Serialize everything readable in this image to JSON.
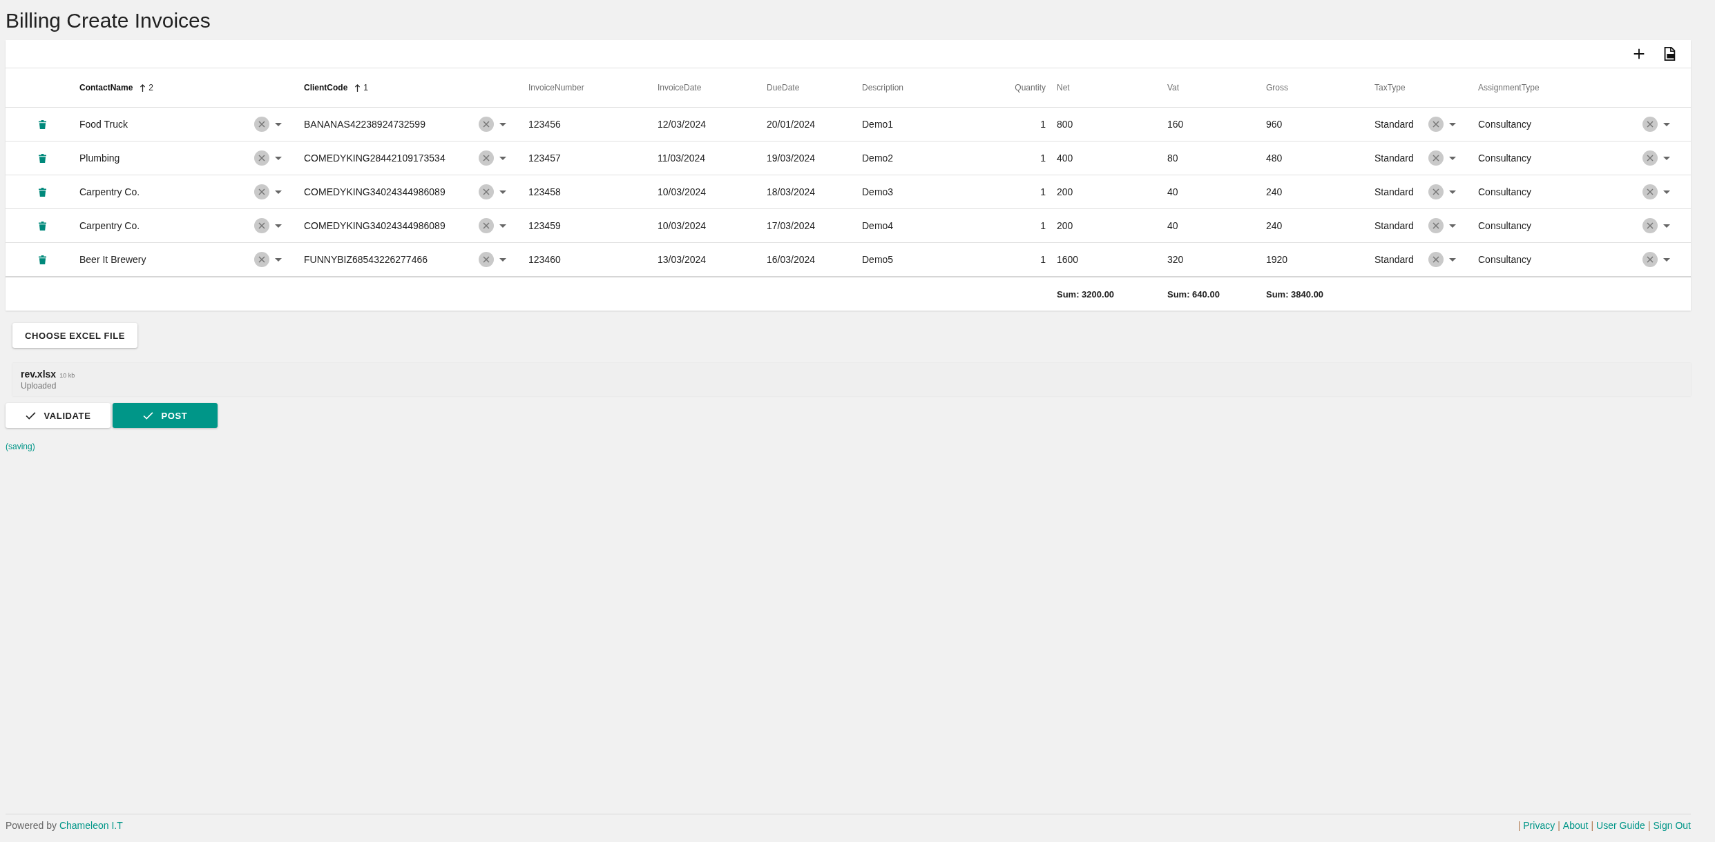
{
  "page_title": "Billing Create Invoices",
  "table": {
    "columns": [
      {
        "label": "ContactName",
        "sorted": true,
        "sort_order": "2",
        "kind": "select"
      },
      {
        "label": "ClientCode",
        "sorted": true,
        "sort_order": "1",
        "kind": "select"
      },
      {
        "label": "InvoiceNumber",
        "sorted": false,
        "kind": "text"
      },
      {
        "label": "InvoiceDate",
        "sorted": false,
        "kind": "text"
      },
      {
        "label": "DueDate",
        "sorted": false,
        "kind": "text"
      },
      {
        "label": "Description",
        "sorted": false,
        "kind": "text"
      },
      {
        "label": "Quantity",
        "sorted": false,
        "kind": "count"
      },
      {
        "label": "Net",
        "sorted": false,
        "kind": "text",
        "total": "Sum: 3200.00"
      },
      {
        "label": "Vat",
        "sorted": false,
        "kind": "text",
        "total": "Sum: 640.00"
      },
      {
        "label": "Gross",
        "sorted": false,
        "kind": "text",
        "total": "Sum: 3840.00"
      },
      {
        "label": "TaxType",
        "sorted": false,
        "kind": "select"
      },
      {
        "label": "AssignmentType",
        "sorted": false,
        "kind": "select"
      }
    ],
    "rows": [
      [
        "Food Truck",
        "BANANAS42238924732599",
        "123456",
        "12/03/2024",
        "20/01/2024",
        "Demo1",
        "1",
        "800",
        "160",
        "960",
        "Standard",
        "Consultancy"
      ],
      [
        "Plumbing",
        "COMEDYKING28442109173534",
        "123457",
        "11/03/2024",
        "19/03/2024",
        "Demo2",
        "1",
        "400",
        "80",
        "480",
        "Standard",
        "Consultancy"
      ],
      [
        "Carpentry Co.",
        "COMEDYKING34024344986089",
        "123458",
        "10/03/2024",
        "18/03/2024",
        "Demo3",
        "1",
        "200",
        "40",
        "240",
        "Standard",
        "Consultancy"
      ],
      [
        "Carpentry Co.",
        "COMEDYKING34024344986089",
        "123459",
        "10/03/2024",
        "17/03/2024",
        "Demo4",
        "1",
        "200",
        "40",
        "240",
        "Standard",
        "Consultancy"
      ],
      [
        "Beer It Brewery",
        "FUNNYBIZ68543226277466",
        "123460",
        "13/03/2024",
        "16/03/2024",
        "Demo5",
        "1",
        "1600",
        "320",
        "1920",
        "Standard",
        "Consultancy"
      ]
    ]
  },
  "choose_file_button": "CHOOSE EXCEL FILE",
  "uploaded_file": {
    "name": "rev.xlsx",
    "size": "10 kb",
    "status": "Uploaded"
  },
  "actions": [
    {
      "label": "VALIDATE",
      "kind": "outlined"
    },
    {
      "label": "POST",
      "kind": "primary"
    }
  ],
  "save_status": "(saving)",
  "footer": {
    "powered_by": "Powered by",
    "company_link": "Chameleon I.T",
    "separator": "|",
    "links": [
      "Privacy",
      "About",
      "User Guide",
      "Sign Out"
    ]
  }
}
